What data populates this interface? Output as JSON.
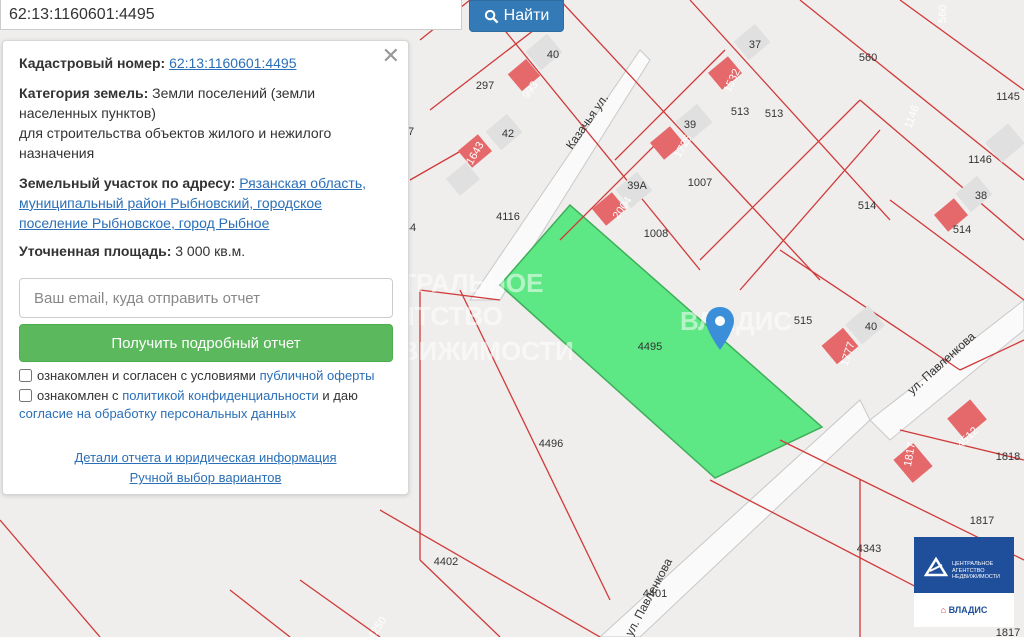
{
  "search": {
    "value": "62:13:1160601:4495",
    "button_label": "Найти",
    "button_color": "#337ab7"
  },
  "info_panel": {
    "cadastral_label": "Кадастровый номер:",
    "cadastral_value": "62:13:1160601:4495",
    "category_label": "Категория земель:",
    "category_value_1": "Земли поселений (земли",
    "category_value_2": "населенных пунктов)",
    "category_value_3": "для строительства объектов жилого и нежилого",
    "category_value_4": "назначения",
    "address_label": "Земельный участок по адресу:",
    "address_1": "Рязанская область,",
    "address_2": "муниципальный район Рыбновский, городское",
    "address_3": "поселение Рыбновское, город Рыбное",
    "area_label": "Уточненная площадь:",
    "area_value": "3 000 кв.м.",
    "email_placeholder": "Ваш email, куда отправить отчет",
    "report_button": "Получить подробный отчет",
    "report_button_color": "#5cb85c",
    "consent_1_text": "ознакомлен и согласен с условиями ",
    "consent_1_link": "публичной оферты",
    "consent_2_text": "ознакомлен с ",
    "consent_2_link_1": "политикой конфиденциальности",
    "consent_2_text_2": " и даю",
    "consent_2_link_2": "согласие на обработку персональных данных",
    "details_link": "Детали отчета и юридическая информация",
    "manual_link": "Ручной выбор вариантов"
  },
  "map": {
    "highlight_color": "#5ee885",
    "boundary_color": "#d03a3a",
    "building_color": "#e5696b",
    "selected_parcel": "4495",
    "parcel_labels": [
      "40",
      "297",
      "993",
      "42",
      "1643",
      "37",
      "37",
      "1532",
      "39",
      "1725",
      "513",
      "560",
      "560",
      "1146",
      "1145",
      "513",
      "1146",
      "1007",
      "39А",
      "2004",
      "1008",
      "4116",
      "44",
      "38",
      "514",
      "514",
      "515",
      "40",
      "1777",
      "4495",
      "4496",
      "1817",
      "1818",
      "4512",
      "1817",
      "1817",
      "4343",
      "4402",
      "4401",
      "4250"
    ],
    "street_labels": [
      "Казачья ул.",
      "ул. Павленкова",
      "ул. Павленкова"
    ],
    "watermark_1": "ЦЕНТРАЛЬНОЕ",
    "watermark_2": "АГЕНТСТВО",
    "watermark_3": "НЕДВИЖИМОСТИ",
    "watermark_brand": "ВЛАДИС",
    "marker_icon": "map-pin-icon"
  },
  "brand": {
    "agency_1": "ЦЕНТРАЛЬНОЕ",
    "agency_2": "АГЕНТСТВО",
    "agency_3": "НЕДВИЖИМОСТИ",
    "name": "ВЛАДИС",
    "color": "#1f4e9a"
  }
}
